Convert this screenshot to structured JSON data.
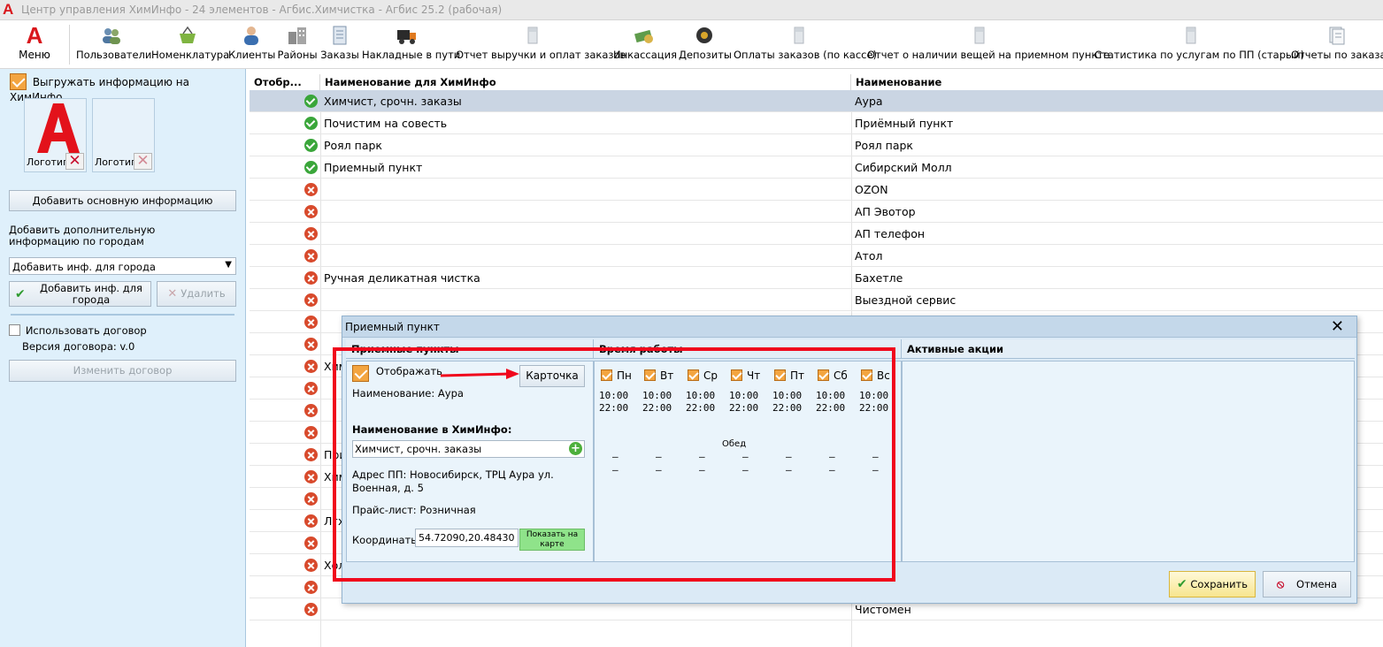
{
  "window": {
    "title": "Центр управления ХимИнфо - 24 элементов - Агбис.Химчистка - Агбис 25.2 (рабочая)",
    "logo_letter": "A"
  },
  "ribbon": {
    "menu_label": "Меню",
    "items": [
      {
        "label": "Пользователи",
        "icon": "users-icon"
      },
      {
        "label": "Номенклатура",
        "icon": "basket-icon"
      },
      {
        "label": "Клиенты",
        "icon": "client-icon"
      },
      {
        "label": "Районы",
        "icon": "buildings-icon"
      },
      {
        "label": "Заказы",
        "icon": "document-icon"
      },
      {
        "label": "Накладные в пути",
        "icon": "truck-icon"
      },
      {
        "label": "Отчет выручки и оплат заказов",
        "icon": "report-icon"
      },
      {
        "label": "Инкассация",
        "icon": "money-icon"
      },
      {
        "label": "Депозиты",
        "icon": "safe-icon"
      },
      {
        "label": "Оплаты заказов (по кассе)",
        "icon": "report-icon"
      },
      {
        "label": "Отчет о наличии вещей на приемном пункте",
        "icon": "report-icon"
      },
      {
        "label": "Статистика по услугам по ПП (старый)",
        "icon": "report-icon"
      },
      {
        "label": "Отчеты по заказам",
        "icon": "reports-icon"
      }
    ]
  },
  "left": {
    "export_label": "Выгружать информацию на ХимИнфо",
    "logo1_label": "Логотип",
    "logo2_label": "Логотип",
    "add_main_info": "Добавить основную информацию",
    "city_info_text": "Добавить дополнительную информацию по городам",
    "city_select": "Добавить инф. для города",
    "add_city_btn": "Добавить инф. для города",
    "delete_btn": "Удалить",
    "use_contract": "Использовать договор",
    "contract_version": "Версия договора: v.0",
    "change_contract": "Изменить договор"
  },
  "grid": {
    "headers": [
      "Отобр...",
      "Наименование для ХимИнфо",
      "Наименование"
    ],
    "rows": [
      {
        "ok": true,
        "hi": "Химчист, срочн. заказы",
        "name": "Аура"
      },
      {
        "ok": true,
        "hi": "Почистим на совесть",
        "name": "Приёмный пункт"
      },
      {
        "ok": true,
        "hi": "Роял парк",
        "name": "Роял парк"
      },
      {
        "ok": true,
        "hi": "Приемный пункт",
        "name": "Сибирский Молл"
      },
      {
        "ok": false,
        "hi": "",
        "name": "OZON"
      },
      {
        "ok": false,
        "hi": "",
        "name": "АП Эвотор"
      },
      {
        "ok": false,
        "hi": "",
        "name": "АП телефон"
      },
      {
        "ok": false,
        "hi": "",
        "name": "Атол"
      },
      {
        "ok": false,
        "hi": "Ручная деликатная чистка",
        "name": "Бахетле"
      },
      {
        "ok": false,
        "hi": "",
        "name": "Выездной сервис"
      },
      {
        "ok": false,
        "hi": "",
        "name": ""
      },
      {
        "ok": false,
        "hi": "",
        "name": ""
      },
      {
        "ok": false,
        "hi": "Хим",
        "name": ""
      },
      {
        "ok": false,
        "hi": "",
        "name": ""
      },
      {
        "ok": false,
        "hi": "",
        "name": ""
      },
      {
        "ok": false,
        "hi": "",
        "name": ""
      },
      {
        "ok": false,
        "hi": "При",
        "name": ""
      },
      {
        "ok": false,
        "hi": "Хим",
        "name": ""
      },
      {
        "ok": false,
        "hi": "",
        "name": ""
      },
      {
        "ok": false,
        "hi": "Лгх",
        "name": ""
      },
      {
        "ok": false,
        "hi": "",
        "name": ""
      },
      {
        "ok": false,
        "hi": "Хол",
        "name": ""
      },
      {
        "ok": false,
        "hi": "",
        "name": ""
      },
      {
        "ok": false,
        "hi": "",
        "name": "Чистомен"
      }
    ]
  },
  "dialog": {
    "title": "Приемный пункт",
    "col_points": "Приемные пункты",
    "col_hours": "Время работы",
    "col_promo": "Активные акции",
    "show_label": "Отображать",
    "card_btn": "Карточка",
    "name_line": "Наименование: Аура",
    "hi_name_label": "Наименование в ХимИнфо:",
    "hi_name_value": "Химчист, срочн. заказы",
    "address": "Адрес ПП: Новосибирск, ТРЦ Аура ул. Военная, д. 5",
    "pricelist": "Прайс-лист: Розничная",
    "coords_label": "Координаты",
    "coords_value": "54.72090,20.48430",
    "map_btn": "Показать на карте",
    "days": [
      "Пн",
      "Вт",
      "Ср",
      "Чт",
      "Пт",
      "Сб",
      "Вс"
    ],
    "open": "10:00",
    "close": "22:00",
    "lunch_label": "Обед",
    "dash": "–",
    "save_btn": "Сохранить",
    "cancel_btn": "Отмена"
  }
}
